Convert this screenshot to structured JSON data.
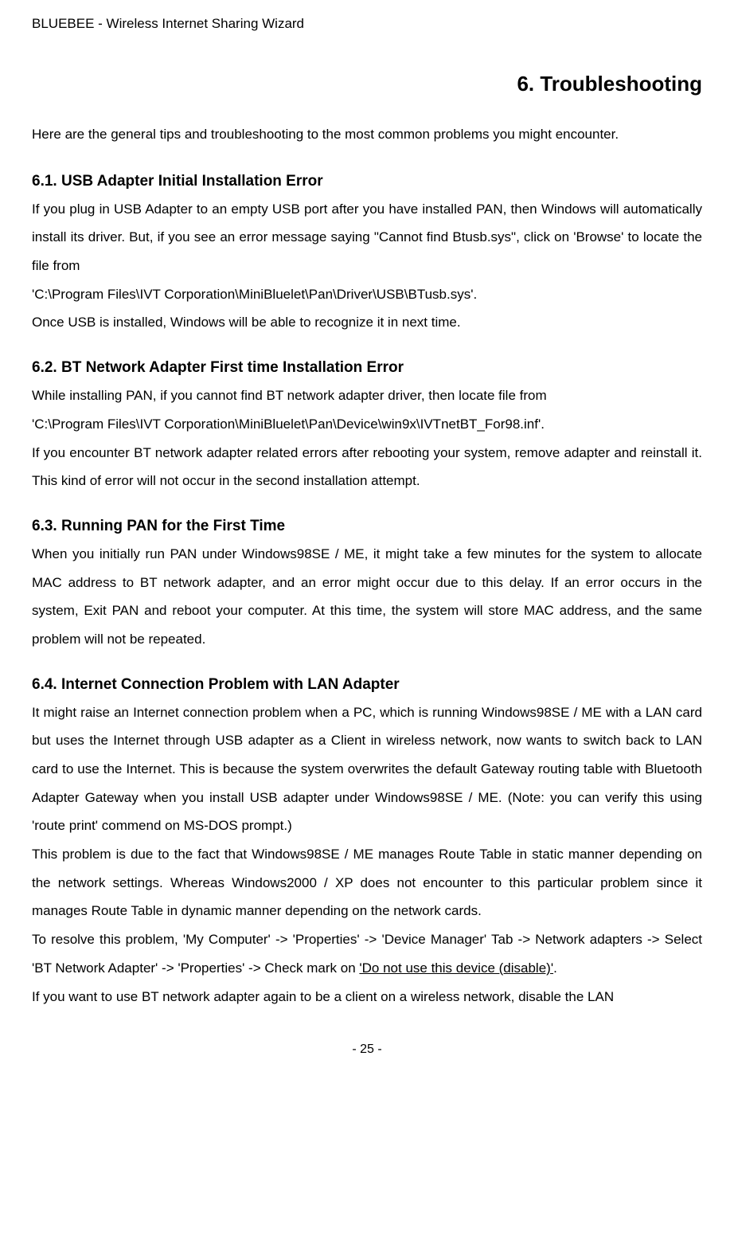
{
  "header": "BLUEBEE - Wireless Internet Sharing Wizard",
  "chapter_title": "6. Troubleshooting",
  "intro": "Here are the general tips and troubleshooting to the most common problems you might encounter.",
  "sections": {
    "s1": {
      "heading": "6.1. USB Adapter Initial Installation Error",
      "body": "If you plug in USB Adapter to an empty USB port after you have installed PAN, then Windows will automatically install its driver. But, if you see an error message saying \"Cannot find Btusb.sys\", click on 'Browse' to locate the file from\n'C:\\Program Files\\IVT Corporation\\MiniBluelet\\Pan\\Driver\\USB\\BTusb.sys'.\nOnce USB is installed, Windows will be able to recognize it in next time."
    },
    "s2": {
      "heading": "6.2. BT Network Adapter First time Installation Error",
      "body": "While installing PAN, if you cannot find BT network adapter driver, then locate file from\n'C:\\Program Files\\IVT Corporation\\MiniBluelet\\Pan\\Device\\win9x\\IVTnetBT_For98.inf'.\nIf you encounter BT network adapter related errors after rebooting your system, remove adapter and reinstall it. This kind of error will not occur in the second installation attempt."
    },
    "s3": {
      "heading": "6.3. Running PAN for the First Time",
      "body": "When you initially run PAN under Windows98SE / ME, it might take a few minutes for the system to allocate MAC address to BT network adapter, and an error might occur due to this delay. If an error occurs in the system, Exit PAN and reboot your computer. At this time, the system will store MAC address, and the same problem will not be repeated."
    },
    "s4": {
      "heading": "6.4. Internet Connection Problem with LAN Adapter",
      "body_pre": "It might raise an Internet connection problem when a PC, which is running Windows98SE / ME with a LAN card but uses the Internet through USB adapter as a Client in wireless network, now wants to switch back to LAN card to use the Internet. This is because the system overwrites the default Gateway routing table with Bluetooth Adapter Gateway when you install USB adapter under Windows98SE / ME. (Note: you can verify this using 'route print' commend on MS-DOS prompt.)\nThis problem is due to the fact that Windows98SE / ME manages Route Table in static manner depending on the network settings. Whereas Windows2000 / XP does not encounter to this particular problem since it manages Route Table in dynamic manner depending on the network cards.\nTo resolve this problem, 'My Computer' -> 'Properties' -> 'Device Manager' Tab -> Network adapters -> Select 'BT Network Adapter' -> 'Properties' -> Check mark on ",
      "underline": "'Do not use this device (disable)'",
      "body_post": ".\nIf you want to use BT network adapter again to be a client on a wireless network, disable the LAN"
    }
  },
  "page_number": "- 25 -"
}
